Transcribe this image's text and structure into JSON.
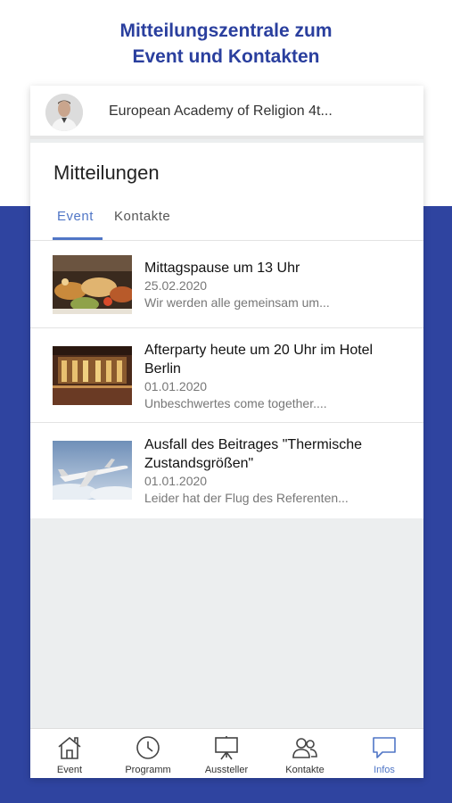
{
  "promo": {
    "line1": "Mitteilungszentrale zum",
    "line2": "Event und Kontakten"
  },
  "event_header": {
    "title": "European Academy of Religion 4t..."
  },
  "panel": {
    "title": "Mitteilungen",
    "tabs": [
      {
        "label": "Event",
        "active": true
      },
      {
        "label": "Kontakte",
        "active": false
      }
    ]
  },
  "messages": [
    {
      "title": "Mittagspause um 13 Uhr",
      "date": "25.02.2020",
      "snippet": "Wir werden alle gemeinsam um...",
      "image": "buffet-food"
    },
    {
      "title": "Afterparty heute um 20 Uhr im Hotel Berlin",
      "date": "01.01.2020",
      "snippet": "Unbeschwertes come together....",
      "image": "hotel-ballroom"
    },
    {
      "title": "Ausfall des Beitrages \"Thermische Zustandsgrößen\"",
      "date": "01.01.2020",
      "snippet": "Leider hat der Flug des Referenten...",
      "image": "airplane"
    }
  ],
  "bottom_nav": [
    {
      "label": "Event",
      "icon": "home-icon",
      "active": false
    },
    {
      "label": "Programm",
      "icon": "clock-icon",
      "active": false
    },
    {
      "label": "Aussteller",
      "icon": "presentation-board-icon",
      "active": false
    },
    {
      "label": "Kontakte",
      "icon": "people-icon",
      "active": false
    },
    {
      "label": "Infos",
      "icon": "chat-bubble-icon",
      "active": true
    }
  ],
  "colors": {
    "brand_blue": "#2f44a0",
    "accent_blue": "#5076c6",
    "headline_blue": "#2a3f9e"
  }
}
